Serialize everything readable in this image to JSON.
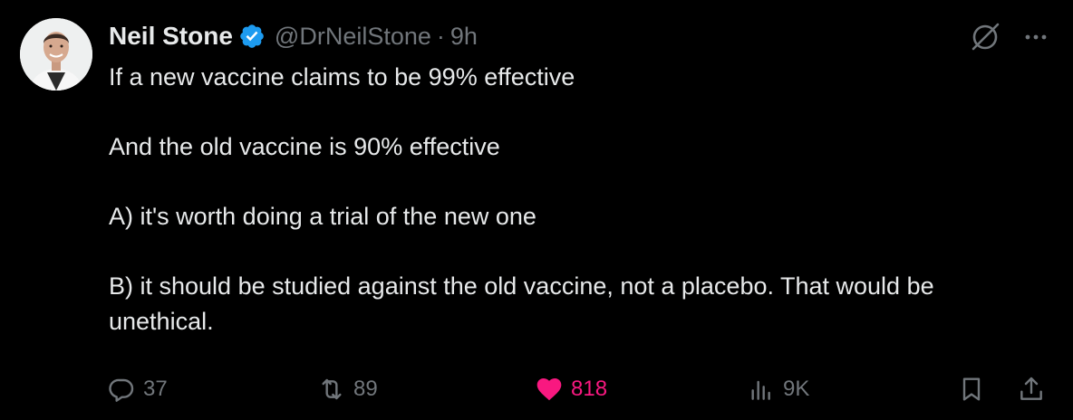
{
  "tweet": {
    "author": {
      "name": "Neil Stone",
      "handle": "@DrNeilStone",
      "separator": "·",
      "time": "9h",
      "verified": true
    },
    "paragraphs": [
      "If a new vaccine claims to be 99% effective",
      "And the old vaccine is 90% effective",
      "A) it's worth doing a trial of the new one",
      "B) it should be studied against the old vaccine, not a placebo. That would be unethical."
    ],
    "metrics": {
      "replies": "37",
      "reposts": "89",
      "likes": "818",
      "views": "9K"
    },
    "liked": true
  },
  "colors": {
    "background": "#000000",
    "text": "#e7e9ea",
    "muted": "#71767b",
    "verified": "#1d9bf0",
    "like": "#f91880"
  },
  "icons": [
    "verified-badge-icon",
    "grok-icon",
    "more-icon",
    "reply-icon",
    "repost-icon",
    "like-heart-icon",
    "views-icon",
    "bookmark-icon",
    "share-icon"
  ]
}
